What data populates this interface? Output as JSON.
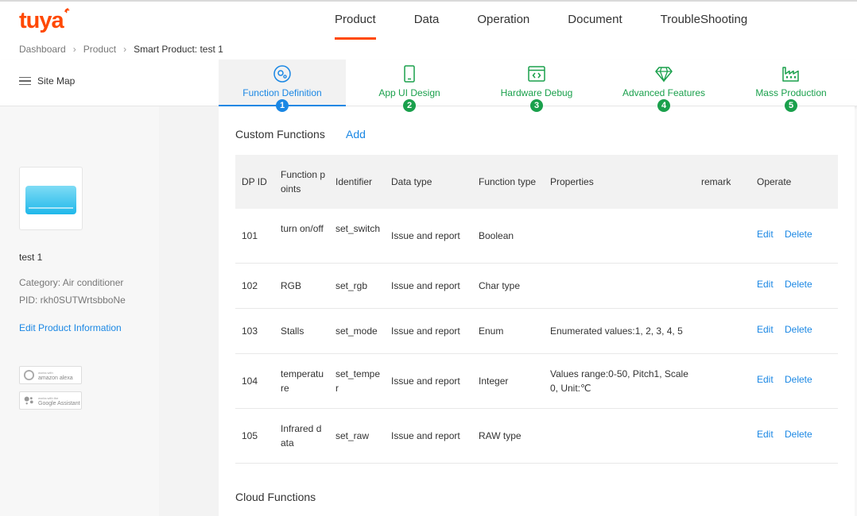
{
  "brand": {
    "logo_text": "tuya",
    "logo_color": "#ff4800"
  },
  "nav": {
    "items": [
      {
        "label": "Product",
        "active": true
      },
      {
        "label": "Data",
        "active": false
      },
      {
        "label": "Operation",
        "active": false
      },
      {
        "label": "Document",
        "active": false
      },
      {
        "label": "TroubleShooting",
        "active": false
      }
    ]
  },
  "breadcrumb": {
    "items": [
      "Dashboard",
      "Product",
      "Smart Product: test 1"
    ]
  },
  "sitemap": {
    "label": "Site Map"
  },
  "steps": [
    {
      "label": "Function Definition",
      "number": "1",
      "icon": "gear-cog-icon",
      "active": true
    },
    {
      "label": "App UI Design",
      "number": "2",
      "icon": "phone-icon",
      "active": false
    },
    {
      "label": "Hardware Debug",
      "number": "3",
      "icon": "code-window-icon",
      "active": false
    },
    {
      "label": "Advanced Features",
      "number": "4",
      "icon": "diamond-icon",
      "active": false
    },
    {
      "label": "Mass Production",
      "number": "5",
      "icon": "factory-icon",
      "active": false
    }
  ],
  "product": {
    "name": "test 1",
    "category": "Category: Air conditioner",
    "pid": "PID: rkh0SUTWrtsbboNe",
    "edit_label": "Edit Product Information",
    "badges": [
      {
        "small": "works with",
        "big": "amazon alexa"
      },
      {
        "small": "works with the",
        "big": "Google Assistant"
      }
    ]
  },
  "custom_functions": {
    "title": "Custom Functions",
    "add_label": "Add",
    "headers": [
      "DP ID",
      "Function points",
      "Identifier",
      "Data type",
      "Function type",
      "Properties",
      "remark",
      "Operate"
    ],
    "rows": [
      {
        "dp_id": "101",
        "point": "turn on/off",
        "identifier": "set_switch",
        "data_type": "Issue and report",
        "func_type": "Boolean",
        "properties": "",
        "remark": "",
        "edit": "Edit",
        "delete": "Delete"
      },
      {
        "dp_id": "102",
        "point": "RGB",
        "identifier": "set_rgb",
        "data_type": "Issue and report",
        "func_type": "Char type",
        "properties": "",
        "remark": "",
        "edit": "Edit",
        "delete": "Delete"
      },
      {
        "dp_id": "103",
        "point": "Stalls",
        "identifier": "set_mode",
        "data_type": "Issue and report",
        "func_type": "Enum",
        "properties": "Enumerated values:1, 2, 3, 4, 5",
        "remark": "",
        "edit": "Edit",
        "delete": "Delete"
      },
      {
        "dp_id": "104",
        "point": "temperature",
        "identifier": "set_temper",
        "data_type": "Issue and report",
        "func_type": "Integer",
        "properties": "Values range:0-50, Pitch1, Scale 0, Unit:℃",
        "remark": "",
        "edit": "Edit",
        "delete": "Delete"
      },
      {
        "dp_id": "105",
        "point": "Infrared data",
        "identifier": "set_raw",
        "data_type": "Issue and report",
        "func_type": "RAW type",
        "properties": "",
        "remark": "",
        "edit": "Edit",
        "delete": "Delete"
      }
    ]
  },
  "cloud_functions": {
    "title": "Cloud Functions"
  },
  "colors": {
    "accent_blue": "#1a87e4",
    "step_green": "#1aa04c",
    "brand_orange": "#ff4800"
  }
}
